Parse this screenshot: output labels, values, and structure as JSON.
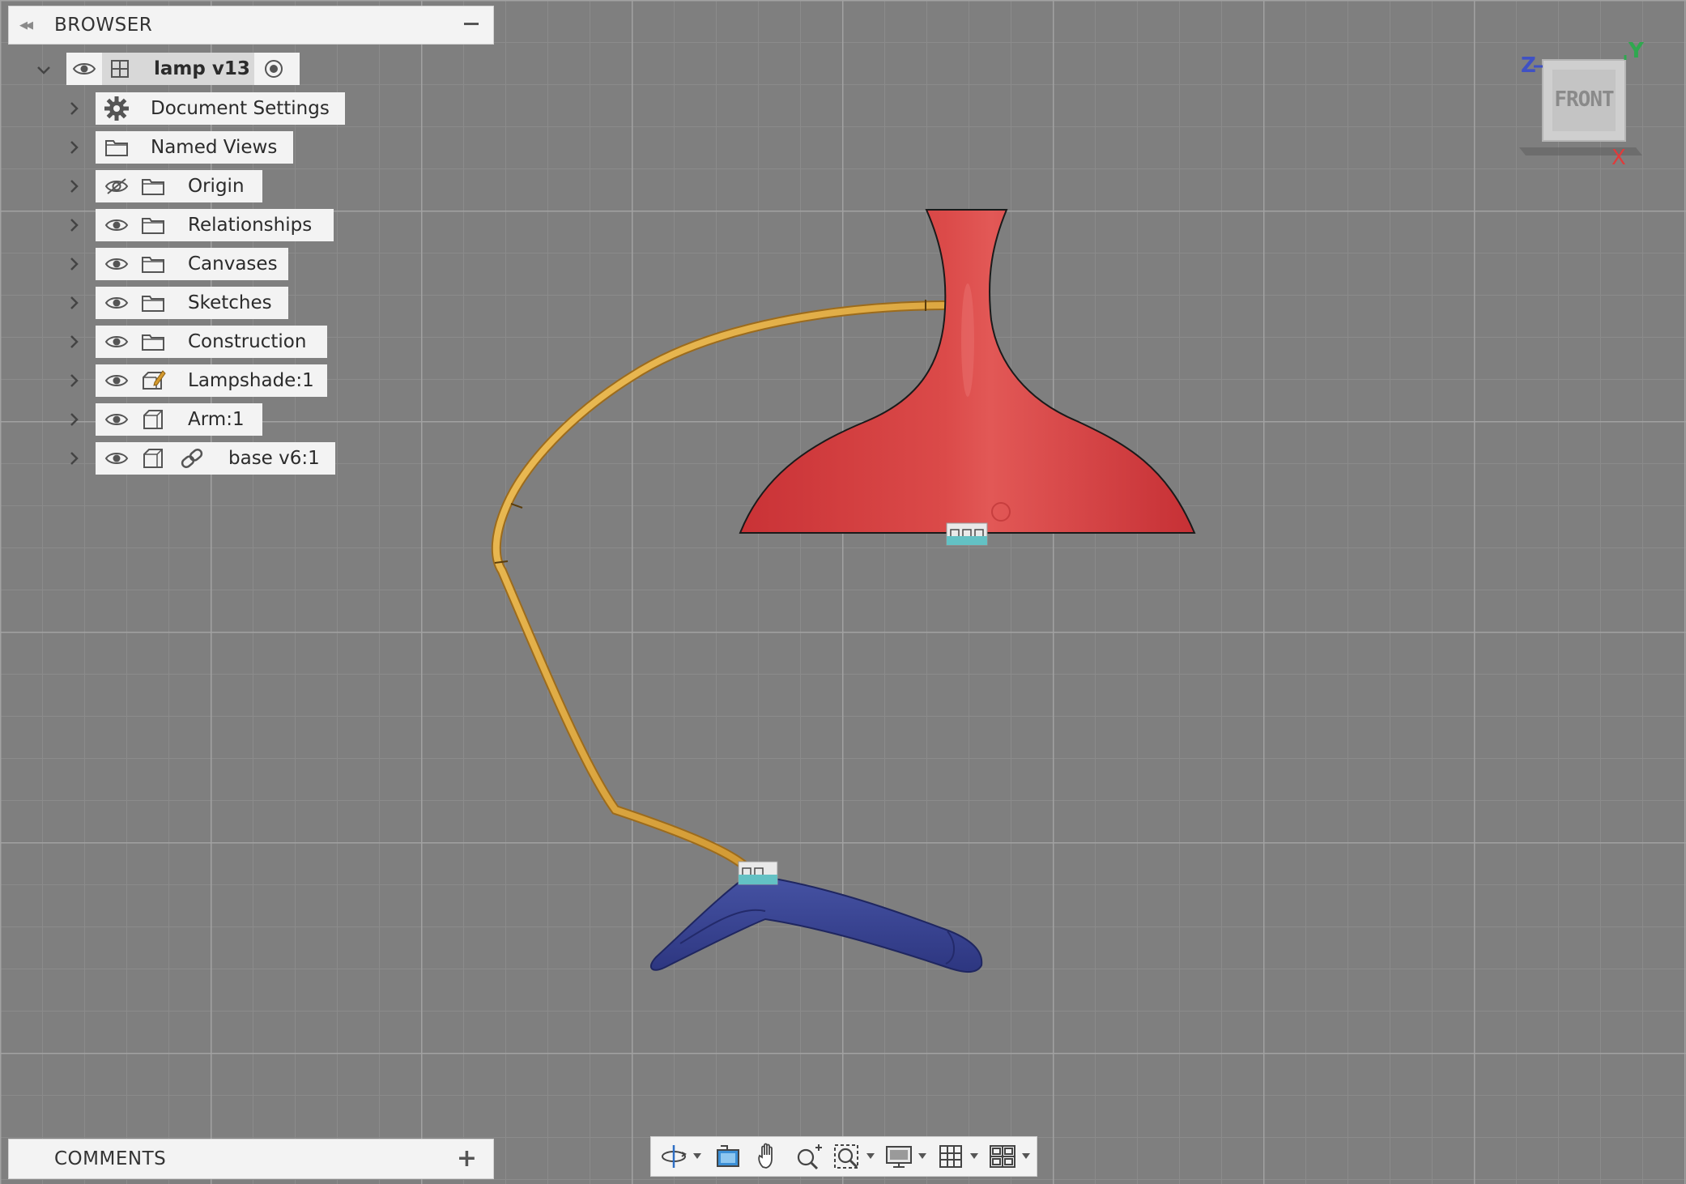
{
  "browser": {
    "title": "BROWSER",
    "root": {
      "label": "lamp v13"
    },
    "items": [
      {
        "label": "Document Settings",
        "icon": "gear-icon"
      },
      {
        "label": "Named Views",
        "icon": "folder-icon"
      },
      {
        "label": "Origin",
        "icon": "folder-icon",
        "visibility": "hidden"
      },
      {
        "label": "Relationships",
        "icon": "folder-icon",
        "visibility": "visible"
      },
      {
        "label": "Canvases",
        "icon": "folder-icon",
        "visibility": "visible"
      },
      {
        "label": "Sketches",
        "icon": "folder-icon",
        "visibility": "visible"
      },
      {
        "label": "Construction",
        "icon": "folder-icon",
        "visibility": "visible"
      },
      {
        "label": "Lampshade:1",
        "icon": "component-edit-icon",
        "visibility": "visible"
      },
      {
        "label": "Arm:1",
        "icon": "component-icon",
        "visibility": "visible"
      },
      {
        "label": "base v6:1",
        "icon": "component-icon",
        "visibility": "visible",
        "linked": true
      }
    ]
  },
  "comments": {
    "title": "COMMENTS"
  },
  "viewcube": {
    "face": "FRONT",
    "axes": {
      "z": "Z",
      "y": "Y",
      "x": "X"
    }
  },
  "toolbar": {
    "tools": [
      "orbit-icon",
      "look-at-icon",
      "pan-icon",
      "zoom-icon",
      "fit-icon",
      "display-settings-icon",
      "grid-icon",
      "viewports-icon"
    ]
  },
  "colors": {
    "lampshade": "#d4393b",
    "arm": "#e2a93a",
    "base": "#3a4592",
    "grid_background": "#7f7f7f",
    "axis_x": "#e03b3b",
    "axis_y": "#2fa84f",
    "axis_z": "#3f51c4"
  }
}
